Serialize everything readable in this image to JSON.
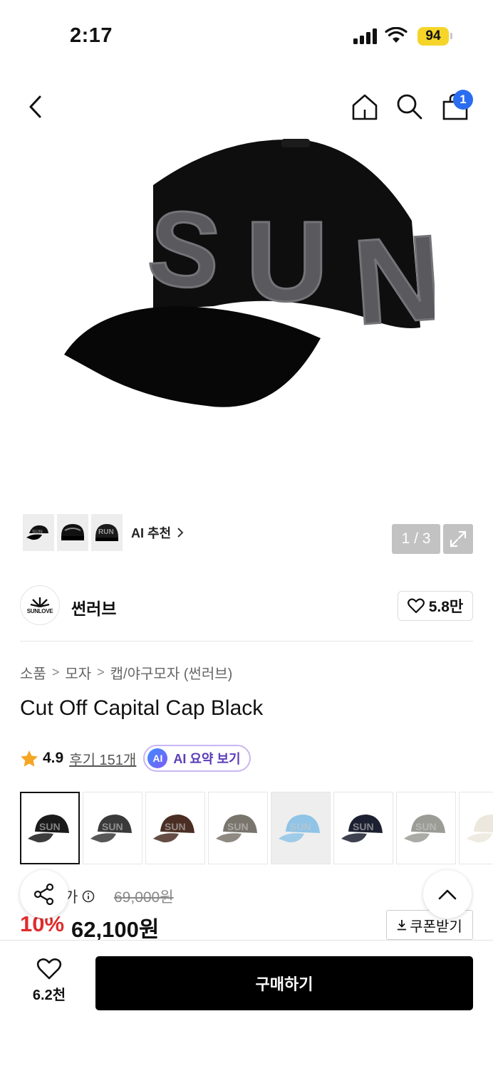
{
  "status_bar": {
    "time": "2:17",
    "battery": "94"
  },
  "nav": {
    "cart_count": "1"
  },
  "gallery": {
    "counter": "1 / 3",
    "ai_recommend": "AI 추천",
    "ai_thumbs": [
      "cap-sun",
      "cap-wave",
      "cap-run"
    ]
  },
  "brand": {
    "name": "썬러브",
    "logo_text": "SUNLOVE",
    "likes": "5.8만"
  },
  "breadcrumb": {
    "items": [
      "소품",
      "모자",
      "캡/야구모자 (썬러브)"
    ]
  },
  "product": {
    "title": "Cut Off Capital Cap Black",
    "rating": "4.9",
    "reviews": "후기 151개",
    "ai_badge": "AI",
    "ai_summary": "AI 요약 보기"
  },
  "colors": {
    "swatches": [
      "#1a1a1a",
      "#3a3a3a",
      "#4a2e24",
      "#7a756c",
      "#8fc4e6",
      "#1c2030",
      "#9c9c96",
      "#ece8de"
    ]
  },
  "price": {
    "label": "정가",
    "label_visible": "가",
    "original": "69,000원",
    "discount": "10%",
    "final": "62,100원",
    "coupon": "쿠폰받기"
  },
  "bottom": {
    "wish_count": "6.2천",
    "buy_label": "구매하기"
  },
  "accent": {
    "blue": "#2b6df0",
    "red": "#e12b2b",
    "battery": "#f5d52a"
  }
}
